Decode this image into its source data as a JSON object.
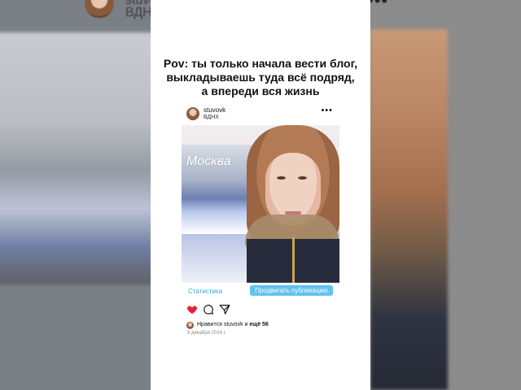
{
  "background": {
    "left_username_partial": "stuvovk",
    "left_location_partial": "ВДНХ",
    "right_more": "•••"
  },
  "caption": {
    "line1": "Pov: ты только начала вести блог,",
    "line2": "выкладываешь туда всё подряд,",
    "line3": "а впереди вся жизнь"
  },
  "post": {
    "username": "stuvovk",
    "location": "ВДНХ",
    "more": "•••",
    "photo_text": "Москва",
    "stats_label": "Статистика",
    "promote_label": "Продвигать публикацию",
    "likes_prefix": "Нравится",
    "likes_user": "stuvovk",
    "likes_and": "и",
    "likes_more": "ещё 56",
    "date": "9 декабря 2014 г."
  },
  "colors": {
    "like_red": "#ed1c3a",
    "link_blue": "#2ea9de",
    "promote_bg": "#5fc3ee"
  },
  "icons": [
    "heart-icon",
    "comment-icon",
    "share-icon"
  ]
}
